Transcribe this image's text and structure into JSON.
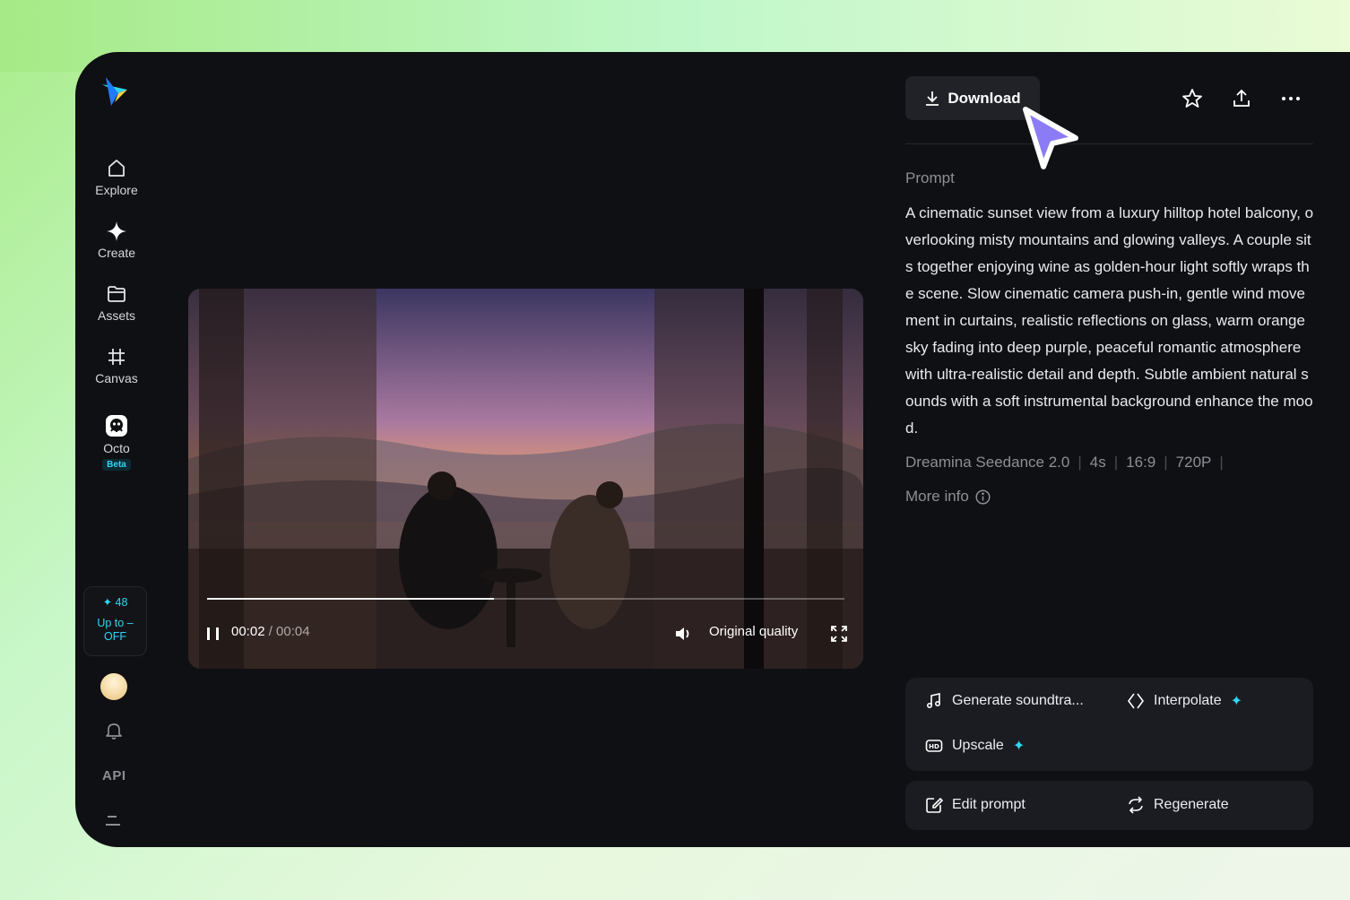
{
  "sidebar": {
    "items": [
      {
        "label": "Explore",
        "icon": "home-icon"
      },
      {
        "label": "Create",
        "icon": "sparkle-icon"
      },
      {
        "label": "Assets",
        "icon": "folder-icon"
      },
      {
        "label": "Canvas",
        "icon": "crop-frame-icon"
      },
      {
        "label": "Octo",
        "icon": "octo-icon",
        "badge": "Beta"
      }
    ],
    "credits": {
      "count": "48",
      "upgrade_line1": "Up to –",
      "upgrade_line2": "OFF"
    },
    "api_label": "API"
  },
  "video": {
    "current_time": "00:02",
    "duration": "/ 00:04",
    "progress": 0.45,
    "quality_label": "Original quality"
  },
  "panel": {
    "download_label": "Download",
    "prompt_label": "Prompt",
    "prompt_text": "A cinematic sunset view from a luxury hilltop hotel balcony, overlooking misty mountains and glowing valleys. A couple sits together enjoying wine as golden-hour light softly wraps the scene. Slow cinematic camera push-in, gentle wind movement in curtains, realistic reflections on glass, warm orange sky fading into deep purple, peaceful romantic atmosphere with ultra-realistic detail and depth. Subtle ambient natural sounds with a soft instrumental background enhance the mood.",
    "meta": {
      "model": "Dreamina Seedance 2.0",
      "duration": "4s",
      "ratio": "16:9",
      "resolution": "720P"
    },
    "more_info_label": "More info",
    "actions": {
      "soundtrack": "Generate soundtra...",
      "interpolate": "Interpolate",
      "upscale": "Upscale",
      "edit_prompt": "Edit prompt",
      "regenerate": "Regenerate"
    }
  },
  "colors": {
    "accent": "#2fd7f2",
    "app_bg": "#0f1013",
    "cursor": "#8b7cf6"
  }
}
